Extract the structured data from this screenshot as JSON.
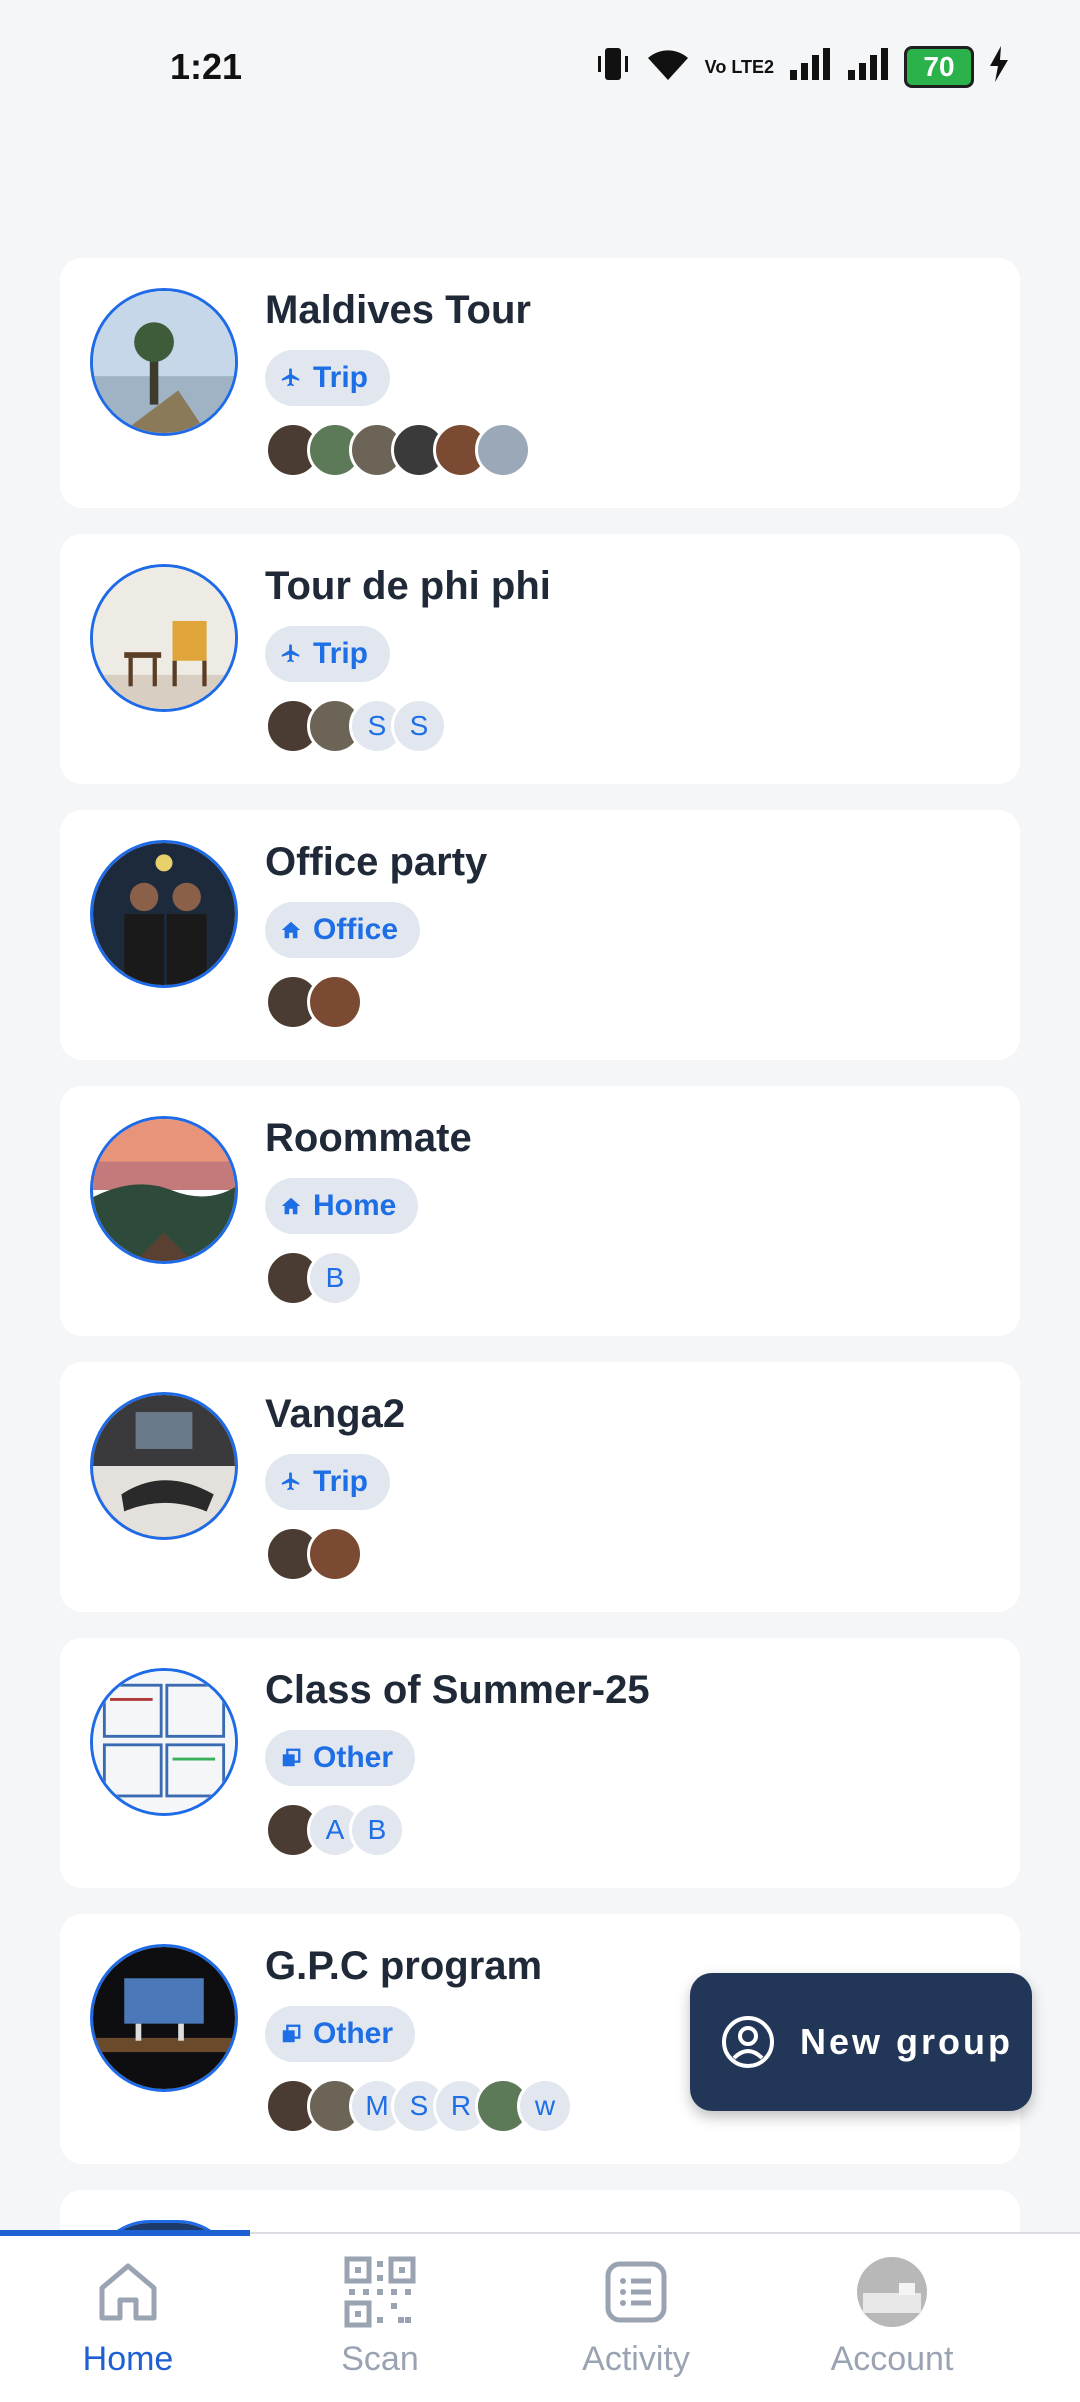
{
  "status_bar": {
    "time": "1:21",
    "battery": "70",
    "network_label": "Vo LTE2"
  },
  "groups": [
    {
      "name": "Maldives Tour",
      "category": "Trip",
      "members": [
        "",
        "",
        "",
        "",
        "",
        ""
      ]
    },
    {
      "name": "Tour de phi phi",
      "category": "Trip",
      "members": [
        "",
        "",
        "S",
        "S"
      ]
    },
    {
      "name": "Office party",
      "category": "Office",
      "members": [
        "",
        ""
      ]
    },
    {
      "name": "Roommate",
      "category": "Home",
      "members": [
        "",
        "B"
      ]
    },
    {
      "name": "Vanga2",
      "category": "Trip",
      "members": [
        "",
        ""
      ]
    },
    {
      "name": "Class of Summer-25",
      "category": "Other",
      "members": [
        "",
        "A",
        "B"
      ]
    },
    {
      "name": "G.P.C program",
      "category": "Other",
      "members": [
        "",
        "",
        "M",
        "S",
        "R",
        "",
        "w"
      ]
    }
  ],
  "fab": {
    "label": "New group",
    "icon": "user-circle-icon"
  },
  "nav": {
    "home": "Home",
    "scan": "Scan",
    "activity": "Activity",
    "account": "Account"
  },
  "colors": {
    "accent": "#1e6ee6",
    "fab_bg": "#223657",
    "chip_bg": "#e2e7ef"
  }
}
